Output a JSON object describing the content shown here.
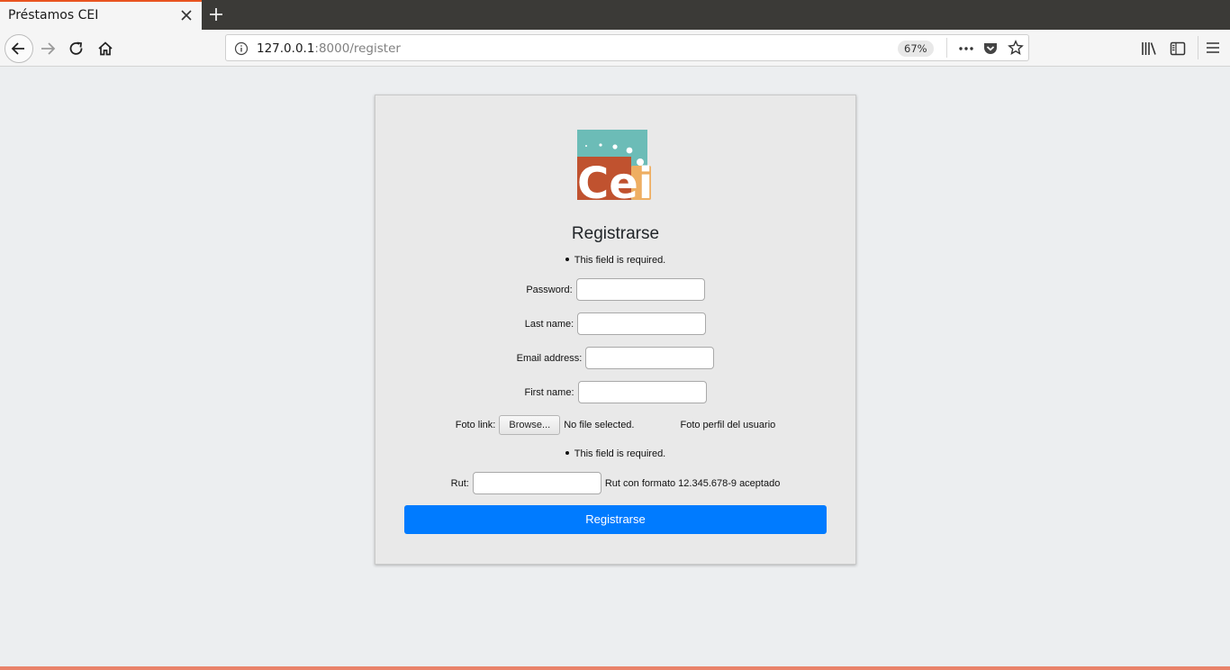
{
  "browser": {
    "tab_title": "Préstamos CEI",
    "url_host": "127.0.0.1",
    "url_rest": ":8000/register",
    "zoom": "67%"
  },
  "page": {
    "heading": "Registrarse",
    "error_top": "This field is required.",
    "fields": {
      "password_label": "Password:",
      "last_name_label": "Last name:",
      "email_label": "Email address:",
      "first_name_label": "First name:",
      "foto_label": "Foto link:",
      "browse_label": "Browse...",
      "no_file": "No file selected.",
      "foto_hint": "Foto perfil del usuario",
      "rut_label": "Rut:",
      "rut_hint": "Rut con formato 12.345.678-9 aceptado"
    },
    "error_rut": "This field is required.",
    "submit_label": "Registrarse",
    "logo_text": "Cei"
  },
  "colors": {
    "accent": "#007bff",
    "tab_highlight": "#e95420",
    "logo_teal": "#6cbcb7",
    "logo_red": "#c0522f",
    "logo_orange": "#eeae62"
  },
  "icons": [
    "close-icon",
    "plus-icon",
    "back-arrow-icon",
    "forward-arrow-icon",
    "reload-icon",
    "home-icon",
    "info-icon",
    "more-icon",
    "pocket-icon",
    "star-icon",
    "library-icon",
    "sidebar-icon",
    "hamburger-menu-icon"
  ]
}
